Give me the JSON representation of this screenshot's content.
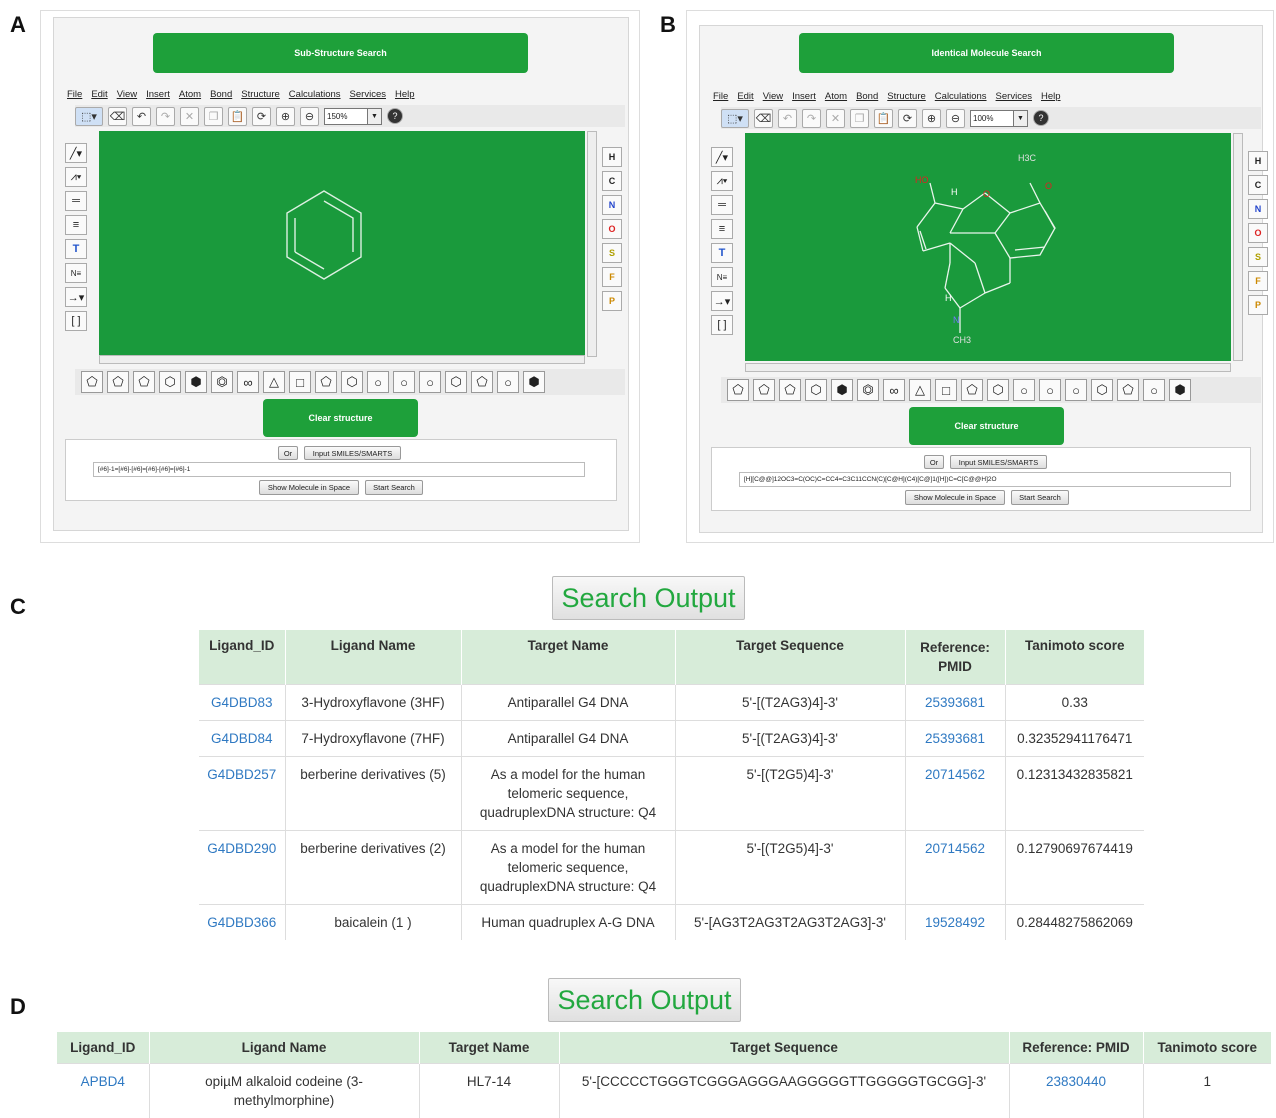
{
  "panel_labels": {
    "a": "A",
    "b": "B",
    "c": "C",
    "d": "D"
  },
  "editor_a": {
    "search_button": "Sub-Structure Search",
    "menu": [
      "File",
      "Edit",
      "View",
      "Insert",
      "Atom",
      "Bond",
      "Structure",
      "Calculations",
      "Services",
      "Help"
    ],
    "zoom": "150%",
    "clear_button": "Clear structure",
    "or_button": "Or",
    "input_smiles_button": "Input SMILES/SMARTS",
    "smiles": "[#6]-1=[#6]-[#6]=[#6]-[#6]=[#6]-1",
    "show_space_button": "Show Molecule in Space",
    "start_search_button": "Start Search"
  },
  "editor_b": {
    "search_button": "Identical Molecule Search",
    "menu": [
      "File",
      "Edit",
      "View",
      "Insert",
      "Atom",
      "Bond",
      "Structure",
      "Calculations",
      "Services",
      "Help"
    ],
    "zoom": "100%",
    "clear_button": "Clear structure",
    "or_button": "Or",
    "input_smiles_button": "Input SMILES/SMARTS",
    "smiles": "[H][C@@]12OC3=C(OC)C=CC4=C3C11CCN(C)[C@H](C4)[C@]1([H])C=C[C@@H]2O",
    "show_space_button": "Show Molecule in Space",
    "start_search_button": "Start Search",
    "atom_labels": {
      "h3c": "H3C",
      "o1": "O",
      "ho": "HO",
      "h1": "H",
      "o2": "O",
      "h2": "H",
      "n": "N",
      "ch3": "CH3"
    }
  },
  "elements": [
    "H",
    "C",
    "N",
    "O",
    "S",
    "F",
    "P"
  ],
  "element_colors": {
    "H": "#222222",
    "C": "#222222",
    "N": "#2244cc",
    "O": "#dd2222",
    "S": "#b0a000",
    "F": "#cc8800",
    "P": "#cc8800"
  },
  "search_output_c": {
    "title": "Search Output",
    "headers": [
      "Ligand_ID",
      "Ligand Name",
      "Target Name",
      "Target Sequence",
      "Reference: PMID",
      "Tanimoto score"
    ],
    "rows": [
      {
        "id": "G4DBD83",
        "name": "3-Hydroxyflavone (3HF)",
        "target": "Antiparallel G4 DNA",
        "seq": "5'-[(T2AG3)4]-3'",
        "pmid": "25393681",
        "score": "0.33"
      },
      {
        "id": "G4DBD84",
        "name": "7-Hydroxyflavone (7HF)",
        "target": "Antiparallel G4 DNA",
        "seq": "5'-[(T2AG3)4]-3'",
        "pmid": "25393681",
        "score": "0.32352941176471"
      },
      {
        "id": "G4DBD257",
        "name": "berberine derivatives (5)",
        "target": "As a model for the human telomeric sequence, quadruplexDNA structure: Q4",
        "seq": "5'-[(T2G5)4]-3'",
        "pmid": "20714562",
        "score": "0.12313432835821"
      },
      {
        "id": "G4DBD290",
        "name": "berberine derivatives (2)",
        "target": "As a model for the human telomeric sequence, quadruplexDNA structure: Q4",
        "seq": "5'-[(T2G5)4]-3'",
        "pmid": "20714562",
        "score": "0.12790697674419"
      },
      {
        "id": "G4DBD366",
        "name": "baicalein (1 )",
        "target": "Human quadruplex A-G DNA",
        "seq": "5'-[AG3T2AG3T2AG3T2AG3]-3'",
        "pmid": "19528492",
        "score": "0.28448275862069"
      }
    ]
  },
  "search_output_d": {
    "title": "Search Output",
    "headers": [
      "Ligand_ID",
      "Ligand Name",
      "Target Name",
      "Target Sequence",
      "Reference: PMID",
      "Tanimoto score"
    ],
    "rows": [
      {
        "id": "APBD4",
        "name": "opiµM alkaloid codeine (3-methylmorphine)",
        "target": "HL7-14",
        "seq": "5'-[CCCCCTGGGTCGGGAGGGAAGGGGGTTGGGGGTGCGG]-3'",
        "pmid": "23830440",
        "score": "1"
      }
    ]
  },
  "colors": {
    "accent_green": "#1ea03a",
    "canvas_green": "#1a9a3c",
    "header_green": "#d7ecd9",
    "link_blue": "#2f79c2",
    "title_green": "#22a83f"
  }
}
